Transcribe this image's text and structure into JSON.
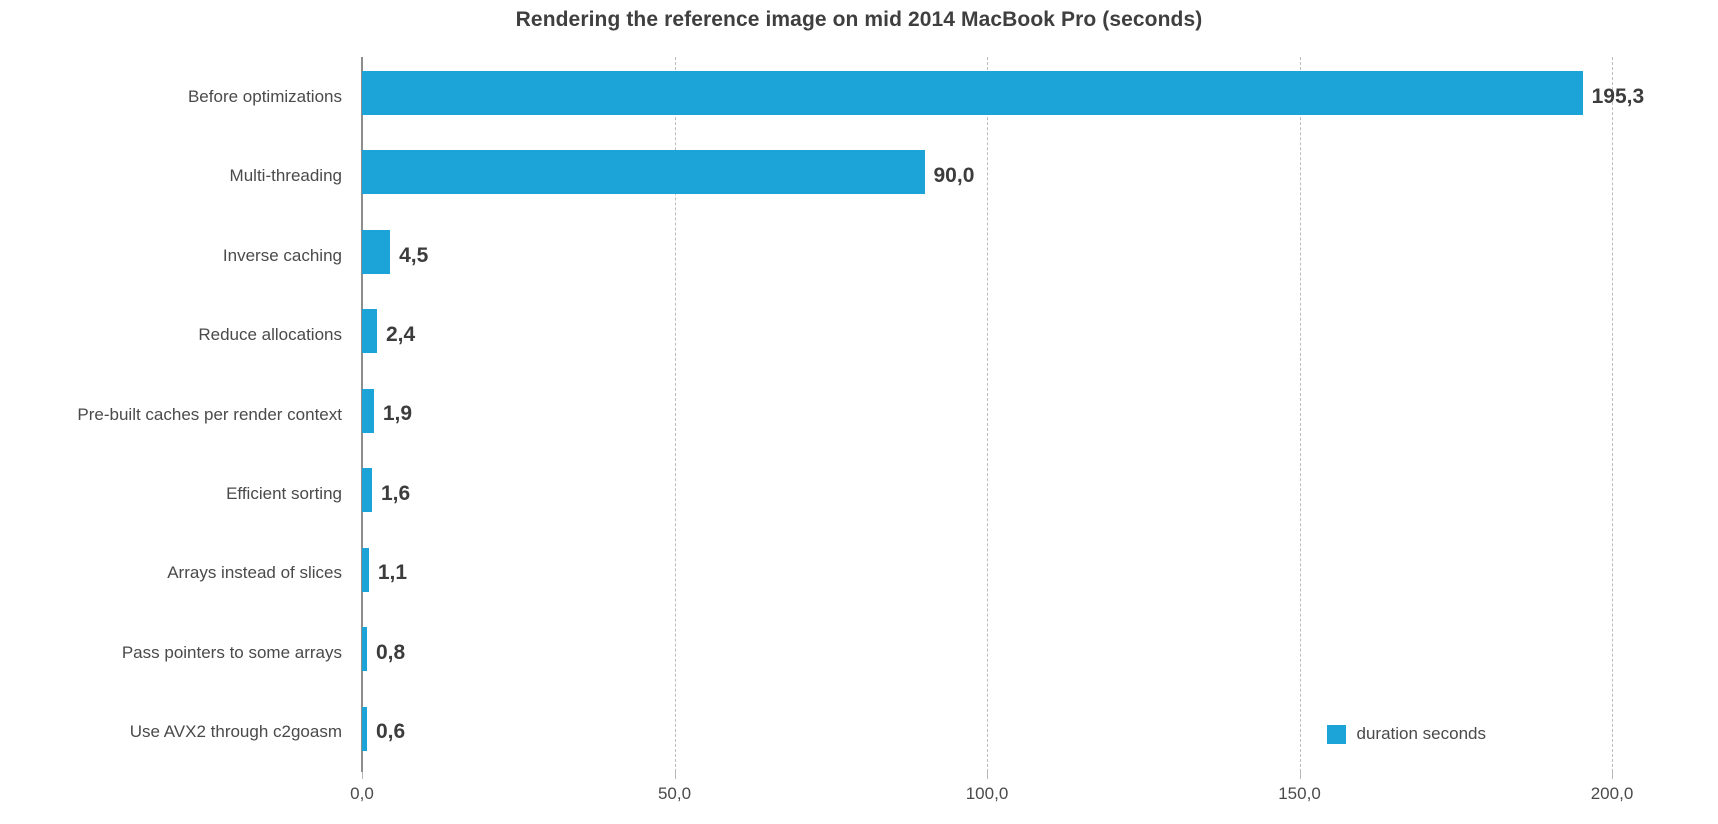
{
  "chart_data": {
    "type": "bar",
    "orientation": "horizontal",
    "title": "Rendering the reference image on mid 2014 MacBook Pro (seconds)",
    "xlabel": "",
    "ylabel": "",
    "xlim": [
      0,
      200
    ],
    "grid": true,
    "grid_axis": "x",
    "grid_style": "dashed",
    "legend_position": "bottom-right",
    "series_color": "#1ca4d8",
    "decimal_separator": ",",
    "categories": [
      "Before optimizations",
      "Multi-threading",
      "Inverse caching",
      "Reduce allocations",
      "Pre-built caches per render context",
      "Efficient sorting",
      "Arrays instead of slices",
      "Pass pointers to some arrays",
      "Use AVX2 through c2goasm"
    ],
    "values": [
      195.3,
      90.0,
      4.5,
      2.4,
      1.9,
      1.6,
      1.1,
      0.8,
      0.6
    ],
    "value_labels": [
      "195,3",
      "90,0",
      "4,5",
      "2,4",
      "1,9",
      "1,6",
      "1,1",
      "0,8",
      "0,6"
    ],
    "series": [
      {
        "name": "duration seconds",
        "values": [
          195.3,
          90.0,
          4.5,
          2.4,
          1.9,
          1.6,
          1.1,
          0.8,
          0.6
        ]
      }
    ],
    "xticks": [
      0,
      50,
      100,
      150,
      200
    ],
    "xtick_labels": [
      "0,0",
      "50,0",
      "100,0",
      "150,0",
      "200,0"
    ],
    "legend": [
      {
        "label": "duration seconds",
        "color": "#1ca4d8"
      }
    ]
  }
}
